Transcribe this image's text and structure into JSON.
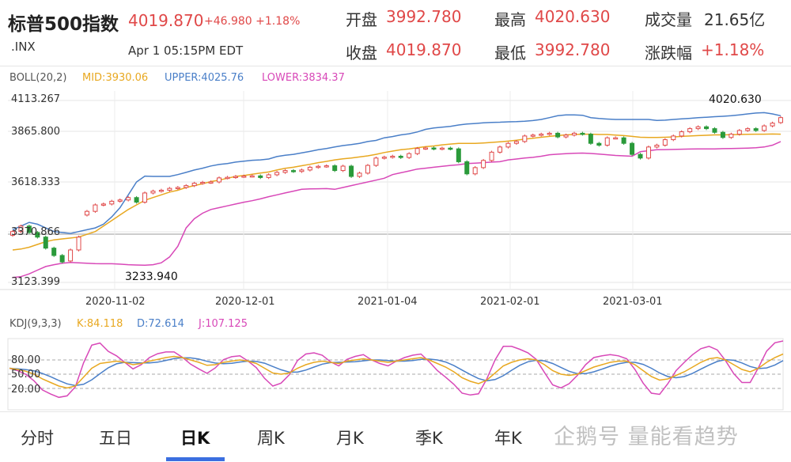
{
  "header": {
    "title": "标普500指数",
    "price": "4019.870",
    "change": "+46.980 +1.18%",
    "symbol": ".INX",
    "time": "Apr 1 05:15PM EDT",
    "stats": [
      {
        "label": "开盘",
        "value": "3992.780"
      },
      {
        "label": "最高",
        "value": "4020.630"
      },
      {
        "label": "成交量",
        "value": "21.65亿"
      },
      {
        "label": "收盘",
        "value": "4019.870"
      },
      {
        "label": "最低",
        "value": "3992.780"
      },
      {
        "label": "涨跌幅",
        "value": "+1.18%"
      }
    ]
  },
  "boll_legend": {
    "name": "BOLL(20,2)",
    "mid": "MID:3930.06",
    "upper": "UPPER:4025.76",
    "lower": "LOWER:3834.37"
  },
  "kdj_legend": {
    "name": "KDJ(9,3,3)",
    "k": "K:84.118",
    "d": "D:72.614",
    "j": "J:107.125"
  },
  "annotations": {
    "high_label": "4020.630",
    "low_label": "3233.940"
  },
  "kdj_axis": [
    "80.00",
    "50.00",
    "20.00"
  ],
  "tabs": [
    "分时",
    "五日",
    "日K",
    "周K",
    "月K",
    "季K",
    "年K"
  ],
  "active_tab": "日K",
  "watermark": "企鹅号 量能看趋势",
  "colors": {
    "up": "#e04848",
    "down": "#2a9a3a",
    "mid": "#e8a820",
    "upper": "#4a7fc8",
    "lower": "#d848b8",
    "tab_active": "#3b6fe0"
  },
  "chart_data": {
    "type": "candlestick",
    "y_ticks": [
      "4113.267",
      "3865.800",
      "3618.333",
      "3370.866",
      "3123.399"
    ],
    "x_ticks": [
      "2020-11-02",
      "2020-12-01",
      "2021-01-04",
      "2021-02-01",
      "2021-03-01"
    ],
    "ylim": [
      3123.399,
      4113.267
    ],
    "close": [
      3400,
      3430,
      3395,
      3370,
      3310,
      3270,
      3235,
      3300,
      3370,
      3510,
      3545,
      3550,
      3565,
      3572,
      3585,
      3560,
      3610,
      3620,
      3625,
      3635,
      3640,
      3650,
      3663,
      3668,
      3670,
      3692,
      3695,
      3700,
      3702,
      3703,
      3694,
      3709,
      3722,
      3732,
      3727,
      3735,
      3750,
      3755,
      3758,
      3732,
      3756,
      3700,
      3718,
      3760,
      3800,
      3805,
      3810,
      3803,
      3824,
      3852,
      3855,
      3850,
      3854,
      3850,
      3780,
      3714,
      3748,
      3787,
      3832,
      3860,
      3880,
      3890,
      3920,
      3925,
      3930,
      3935,
      3915,
      3925,
      3935,
      3930,
      3880,
      3870,
      3910,
      3910,
      3880,
      3820,
      3800,
      3860,
      3870,
      3900,
      3920,
      3943,
      3960,
      3970,
      3960,
      3940,
      3912,
      3930,
      3950,
      3960,
      3950,
      3975,
      3990,
      4020
    ],
    "open": [
      3380,
      3400,
      3430,
      3395,
      3370,
      3310,
      3270,
      3240,
      3300,
      3490,
      3510,
      3545,
      3550,
      3565,
      3572,
      3585,
      3560,
      3610,
      3620,
      3625,
      3635,
      3640,
      3650,
      3663,
      3668,
      3670,
      3692,
      3695,
      3700,
      3702,
      3703,
      3694,
      3709,
      3722,
      3732,
      3727,
      3735,
      3750,
      3755,
      3758,
      3732,
      3756,
      3700,
      3718,
      3760,
      3800,
      3805,
      3810,
      3803,
      3824,
      3852,
      3855,
      3850,
      3854,
      3850,
      3780,
      3714,
      3748,
      3787,
      3832,
      3860,
      3880,
      3890,
      3920,
      3925,
      3930,
      3935,
      3915,
      3925,
      3935,
      3930,
      3880,
      3870,
      3910,
      3910,
      3880,
      3820,
      3800,
      3860,
      3870,
      3900,
      3920,
      3943,
      3960,
      3970,
      3960,
      3940,
      3912,
      3930,
      3950,
      3960,
      3950,
      3975,
      3993
    ],
    "mid": [
      3300,
      3305,
      3315,
      3330,
      3345,
      3355,
      3360,
      3365,
      3370,
      3385,
      3400,
      3430,
      3460,
      3490,
      3520,
      3545,
      3570,
      3585,
      3600,
      3615,
      3625,
      3640,
      3650,
      3660,
      3672,
      3680,
      3690,
      3700,
      3705,
      3712,
      3718,
      3724,
      3735,
      3744,
      3750,
      3758,
      3766,
      3775,
      3782,
      3790,
      3796,
      3800,
      3806,
      3812,
      3820,
      3830,
      3838,
      3845,
      3850,
      3856,
      3862,
      3866,
      3872,
      3876,
      3880,
      3880,
      3880,
      3882,
      3885,
      3888,
      3892,
      3897,
      3903,
      3908,
      3913,
      3918,
      3922,
      3926,
      3928,
      3930,
      3930,
      3928,
      3928,
      3925,
      3922,
      3918,
      3913,
      3912,
      3912,
      3913,
      3915,
      3918,
      3920,
      3922,
      3924,
      3926,
      3926,
      3927,
      3928,
      3929,
      3930,
      3930,
      3931,
      3930
    ],
    "upper": [
      3410,
      3430,
      3450,
      3440,
      3420,
      3400,
      3395,
      3390,
      3400,
      3410,
      3420,
      3440,
      3480,
      3530,
      3600,
      3670,
      3702,
      3700,
      3700,
      3700,
      3710,
      3722,
      3735,
      3745,
      3757,
      3765,
      3770,
      3778,
      3783,
      3788,
      3790,
      3795,
      3808,
      3815,
      3820,
      3828,
      3836,
      3845,
      3852,
      3860,
      3868,
      3873,
      3880,
      3890,
      3896,
      3910,
      3917,
      3926,
      3932,
      3942,
      3956,
      3964,
      3968,
      3972,
      3980,
      3985,
      3988,
      3992,
      3994,
      3995,
      3997,
      3998,
      4000,
      4004,
      4010,
      4020,
      4030,
      4035,
      4035,
      4033,
      4020,
      4015,
      4012,
      4010,
      4010,
      4010,
      4010,
      4010,
      4005,
      4006,
      4010,
      4013,
      4016,
      4020,
      4022,
      4025,
      4027,
      4030,
      4035,
      4040,
      4045,
      4047,
      4040,
      4030
    ],
    "lower": [
      3150,
      3155,
      3170,
      3190,
      3210,
      3220,
      3228,
      3232,
      3230,
      3228,
      3226,
      3225,
      3225,
      3223,
      3220,
      3218,
      3217,
      3220,
      3230,
      3262,
      3320,
      3420,
      3470,
      3500,
      3520,
      3530,
      3540,
      3550,
      3560,
      3568,
      3578,
      3590,
      3600,
      3610,
      3620,
      3630,
      3632,
      3633,
      3634,
      3630,
      3640,
      3650,
      3660,
      3670,
      3680,
      3690,
      3710,
      3720,
      3730,
      3740,
      3745,
      3750,
      3755,
      3760,
      3764,
      3770,
      3772,
      3775,
      3778,
      3780,
      3790,
      3795,
      3800,
      3804,
      3810,
      3818,
      3821,
      3824,
      3826,
      3827,
      3825,
      3822,
      3818,
      3814,
      3812,
      3810,
      3835,
      3840,
      3845,
      3846,
      3847,
      3848,
      3849,
      3850,
      3850,
      3850,
      3851,
      3852,
      3853,
      3854,
      3856,
      3860,
      3870,
      3890
    ]
  }
}
